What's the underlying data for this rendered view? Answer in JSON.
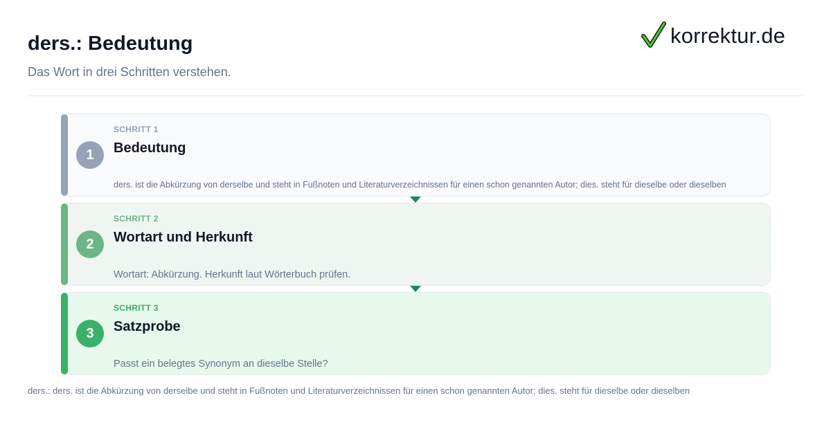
{
  "header": {
    "title": "ders.: Bedeutung",
    "subtitle": "Das Wort in drei Schritten verstehen."
  },
  "logo": {
    "text": "korrektur.de",
    "icon": "checkmark-icon"
  },
  "steps": [
    {
      "number": "1",
      "eyebrow": "SCHRITT 1",
      "heading": "Bedeutung",
      "description": "ders. ist die Abkürzung von derselbe und steht in Fußnoten und Literaturverzeichnissen für einen schon genannten Autor; dies. steht für dieselbe oder dieselben"
    },
    {
      "number": "2",
      "eyebrow": "SCHRITT 2",
      "heading": "Wortart und Herkunft",
      "description": "Wortart: Abkürzung. Herkunft laut Wörterbuch prüfen."
    },
    {
      "number": "3",
      "eyebrow": "SCHRITT 3",
      "heading": "Satzprobe",
      "description": "Passt ein belegtes Synonym an dieselbe Stelle?"
    }
  ],
  "footer": {
    "text": "ders.: ders. ist die Abkürzung von derselbe und steht in Fußnoten und Literaturverzeichnissen für einen schon genannten Autor; dies. steht für dieselbe oder dieselben"
  },
  "colors": {
    "step1": "#94a3b8",
    "step2": "#6db584",
    "step3": "#3ab068",
    "arrow": "#1f8a4c",
    "logo_check_green": "#5ccb1f"
  }
}
